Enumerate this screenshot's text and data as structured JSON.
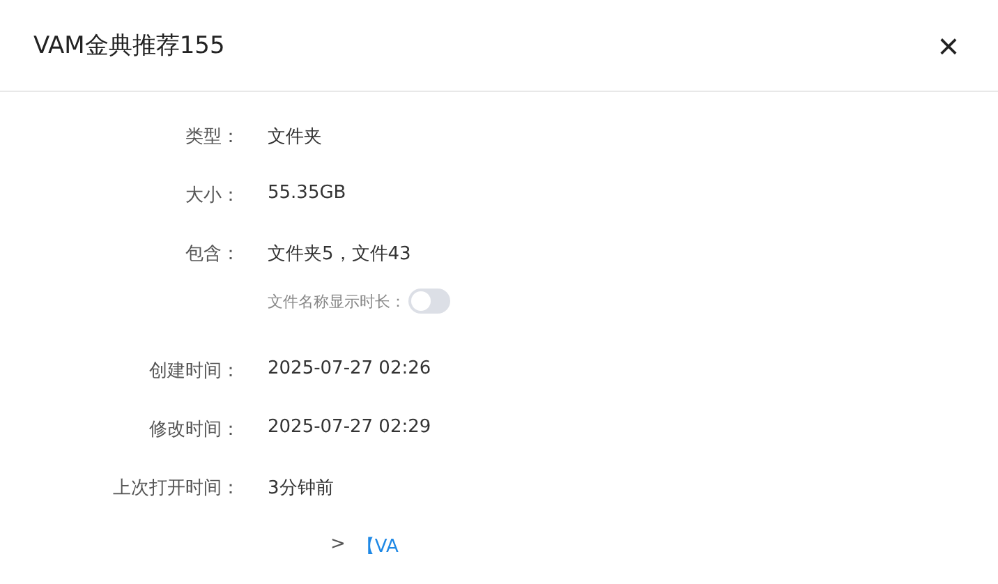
{
  "dialog": {
    "title": "VAM金典推荐155",
    "close": "×"
  },
  "rows": [
    {
      "kind": "text",
      "label": "类型：",
      "value": "文件夹"
    },
    {
      "kind": "text",
      "label": "大小：",
      "value": "55.35GB"
    },
    {
      "kind": "text",
      "label": "包含：",
      "value": "文件夹5，文件43"
    },
    {
      "kind": "toggle",
      "label": "文件名称显示时长：",
      "on": false
    },
    {
      "kind": "text",
      "label": "创建时间：",
      "value": "2025-07-27 02:26"
    },
    {
      "kind": "text",
      "label": "修改时间：",
      "value": "2025-07-27 02:29"
    },
    {
      "kind": "text",
      "label": "上次打开时间：",
      "value": "3分钟前"
    },
    {
      "kind": "path",
      "parts": [
        {
          "text": ">",
          "link": false
        },
        {
          "text": "【VA",
          "link": true
        }
      ]
    }
  ]
}
